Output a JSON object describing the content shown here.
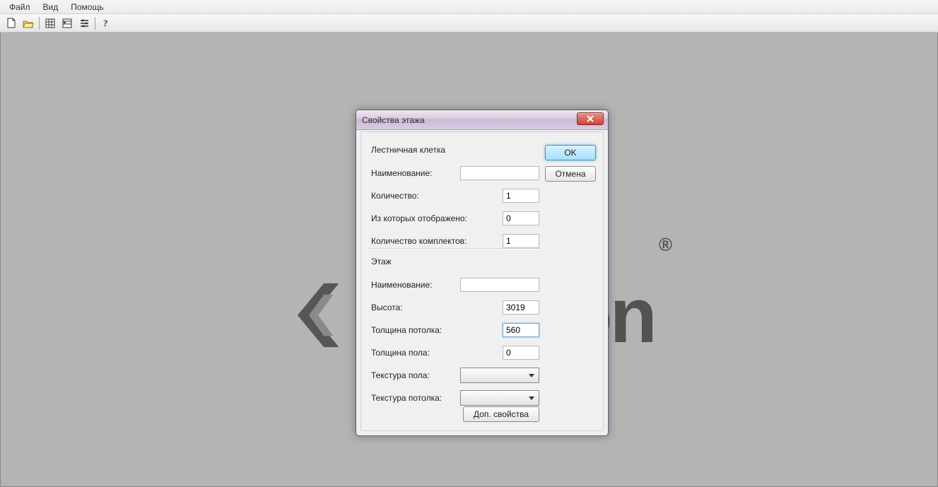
{
  "menu": {
    "file": "Файл",
    "view": "Вид",
    "help": "Помощь"
  },
  "dialog": {
    "title": "Свойства этажа",
    "ok": "OK",
    "cancel": "Отмена",
    "extra": "Доп. свойства",
    "group_stair": "Лестничная клетка",
    "group_floor": "Этаж",
    "labels": {
      "name": "Наименование:",
      "count": "Количество:",
      "shown": "Из которых отображено:",
      "sets": "Количество комплектов:",
      "height": "Высота:",
      "ceil_thick": "Толщина потолка:",
      "floor_thick": "Толщина пола:",
      "floor_tex": "Текстура пола:",
      "ceil_tex": "Текстура потолка:"
    },
    "values": {
      "stair_name": "",
      "count": "1",
      "shown": "0",
      "sets": "1",
      "floor_name": "",
      "height": "3019",
      "ceil_thick": "560",
      "floor_thick": "0",
      "floor_tex": "",
      "ceil_tex": ""
    }
  },
  "logo": {
    "suffix": "on",
    "reg": "®"
  }
}
